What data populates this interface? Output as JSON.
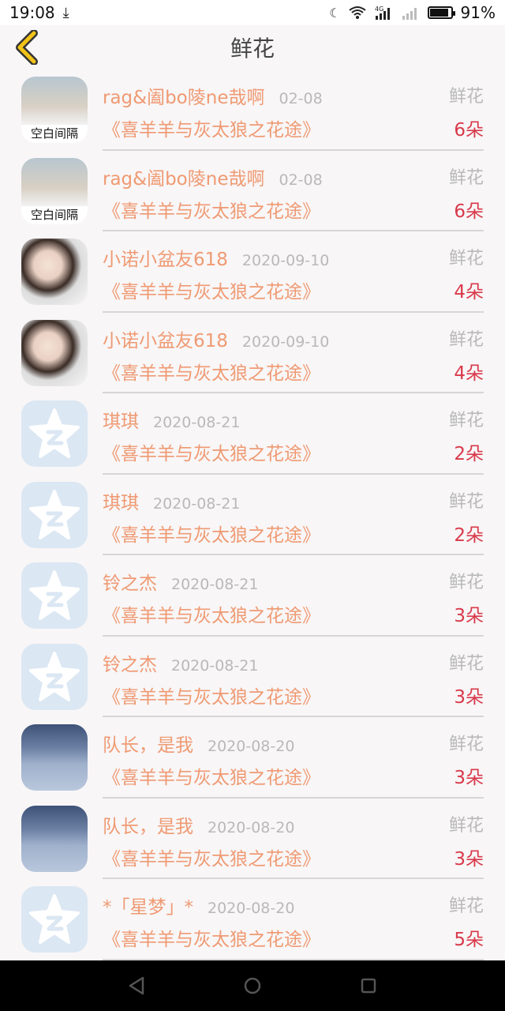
{
  "status_bar": {
    "time": "19:08",
    "battery_percent": "91%",
    "battery_level": 0.91,
    "network_label": "4G"
  },
  "header": {
    "title": "鲜花",
    "accent_color": "#f2c318"
  },
  "colors": {
    "name": "#ef9a73",
    "date": "#b9b9b9",
    "count": "#d9394a"
  },
  "rows": [
    {
      "avatar": "photo1",
      "avatar_caption": "空白间隔",
      "name": "rag&阖bo陵ne哉啊",
      "date": "02-08",
      "type": "鲜花",
      "title": "《喜羊羊与灰太狼之花途》",
      "count": "6朵"
    },
    {
      "avatar": "photo1",
      "avatar_caption": "空白间隔",
      "name": "rag&阖bo陵ne哉啊",
      "date": "02-08",
      "type": "鲜花",
      "title": "《喜羊羊与灰太狼之花途》",
      "count": "6朵"
    },
    {
      "avatar": "photo2",
      "avatar_caption": "",
      "name": "小诺小盆友618",
      "date": "2020-09-10",
      "type": "鲜花",
      "title": "《喜羊羊与灰太狼之花途》",
      "count": "4朵"
    },
    {
      "avatar": "photo2",
      "avatar_caption": "",
      "name": "小诺小盆友618",
      "date": "2020-09-10",
      "type": "鲜花",
      "title": "《喜羊羊与灰太狼之花途》",
      "count": "4朵"
    },
    {
      "avatar": "qq",
      "avatar_caption": "",
      "name": "琪琪",
      "date": "2020-08-21",
      "type": "鲜花",
      "title": "《喜羊羊与灰太狼之花途》",
      "count": "2朵"
    },
    {
      "avatar": "qq",
      "avatar_caption": "",
      "name": "琪琪",
      "date": "2020-08-21",
      "type": "鲜花",
      "title": "《喜羊羊与灰太狼之花途》",
      "count": "2朵"
    },
    {
      "avatar": "qq",
      "avatar_caption": "",
      "name": "铃之杰",
      "date": "2020-08-21",
      "type": "鲜花",
      "title": "《喜羊羊与灰太狼之花途》",
      "count": "3朵"
    },
    {
      "avatar": "qq",
      "avatar_caption": "",
      "name": "铃之杰",
      "date": "2020-08-21",
      "type": "鲜花",
      "title": "《喜羊羊与灰太狼之花途》",
      "count": "3朵"
    },
    {
      "avatar": "photo3",
      "avatar_caption": "",
      "name": "队长，是我",
      "date": "2020-08-20",
      "type": "鲜花",
      "title": "《喜羊羊与灰太狼之花途》",
      "count": "3朵"
    },
    {
      "avatar": "photo3",
      "avatar_caption": "",
      "name": "队长，是我",
      "date": "2020-08-20",
      "type": "鲜花",
      "title": "《喜羊羊与灰太狼之花途》",
      "count": "3朵"
    },
    {
      "avatar": "qq",
      "avatar_caption": "",
      "name": "*「星梦」*",
      "date": "2020-08-20",
      "type": "鲜花",
      "title": "《喜羊羊与灰太狼之花途》",
      "count": "5朵"
    }
  ]
}
